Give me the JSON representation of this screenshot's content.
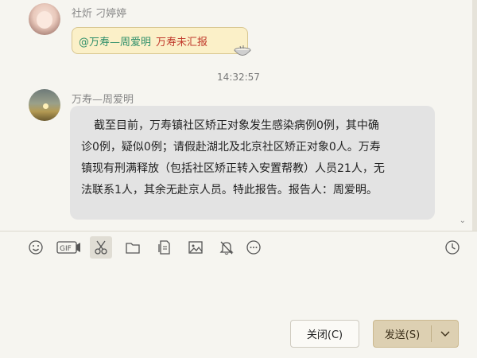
{
  "messages": [
    {
      "sender": "社炘 刁婷婷",
      "mention": "@万寿—周爱明",
      "text": "万寿未汇报",
      "emoji": "bowl-emoji"
    },
    {
      "sender": "万寿—周爱明",
      "lines": [
        "截至目前，万寿镇社区矫正对象发生感染病例0例，其中确",
        "诊0例，疑似0例；请假赴湖北及北京社区矫正对象0人。万寿",
        "镇现有刑满释放（包括社区矫正转入安置帮教）人员21人，无",
        "法联系1人，其余无赴京人员。特此报告。报告人：周爱明。"
      ]
    }
  ],
  "timestamp": "14:32:57",
  "toolbar": {
    "items": [
      "emoji-icon",
      "gif-icon",
      "scissors-icon",
      "folder-icon",
      "file-icon",
      "image-icon",
      "bell-off-icon",
      "more-icon",
      "history-icon"
    ],
    "active": "scissors-icon"
  },
  "buttons": {
    "close_label": "关闭(C)",
    "send_label": "发送(S)"
  },
  "colors": {
    "background": "#f6f5f0",
    "mention": "#2f8f6a",
    "alert_text": "#c0392b",
    "bubble_highlight": "#fbf0c8",
    "bubble_gray": "#e3e3e3",
    "send_button": "#ddd0b2"
  }
}
